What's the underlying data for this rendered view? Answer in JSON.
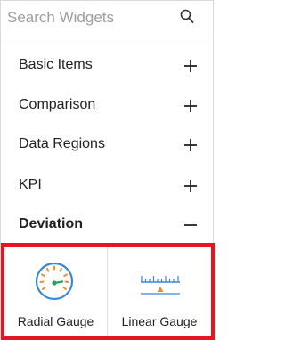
{
  "search": {
    "placeholder": "Search Widgets",
    "value": ""
  },
  "categories": [
    {
      "label": "Basic Items",
      "state": "collapsed",
      "toggle": "+"
    },
    {
      "label": "Comparison",
      "state": "collapsed",
      "toggle": "+"
    },
    {
      "label": "Data Regions",
      "state": "collapsed",
      "toggle": "+"
    },
    {
      "label": "KPI",
      "state": "collapsed",
      "toggle": "+"
    },
    {
      "label": "Deviation",
      "state": "expanded",
      "toggle": "−"
    }
  ],
  "widgets": [
    {
      "label": "Radial Gauge",
      "icon": "radial-gauge-icon"
    },
    {
      "label": "Linear Gauge",
      "icon": "linear-gauge-icon"
    }
  ],
  "colors": {
    "highlight_border": "#e8141f",
    "gauge_blue": "#3a86d8",
    "gauge_orange": "#f08c2e",
    "gauge_green": "#2e9e5b"
  }
}
